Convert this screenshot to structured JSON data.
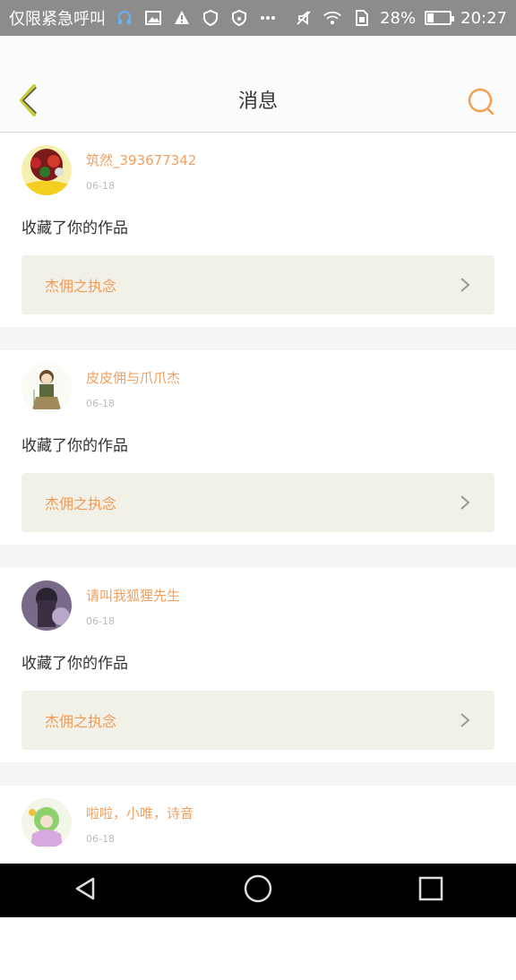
{
  "status_bar": {
    "carrier": "仅限紧急呼叫",
    "battery_percent": "28%",
    "time": "20:27",
    "icons_left": [
      "headset-icon",
      "image-icon",
      "warning-icon",
      "shield-icon",
      "shield-wifi-icon",
      "more-icon"
    ],
    "icons_right": [
      "mute-icon",
      "wifi-icon",
      "sim-icon",
      "battery-icon"
    ]
  },
  "header": {
    "title": "消息",
    "back_icon": "chevron-left-icon",
    "search_icon": "search-icon"
  },
  "messages": [
    {
      "username": "筑然_393677342",
      "date": "06-18",
      "action": "收藏了你的作品",
      "work_title": "杰佣之执念"
    },
    {
      "username": "皮皮佣与爪爪杰",
      "date": "06-18",
      "action": "收藏了你的作品",
      "work_title": "杰佣之执念"
    },
    {
      "username": "请叫我狐狸先生",
      "date": "06-18",
      "action": "收藏了你的作品",
      "work_title": "杰佣之执念"
    },
    {
      "username": "啦啦，小唯，诗音",
      "date": "06-18"
    }
  ],
  "nav_bar": {
    "icons": [
      "back-icon",
      "home-icon",
      "recents-icon"
    ]
  },
  "colors": {
    "accent": "#f29a56",
    "link_bg": "#f1f1e8",
    "status_bg": "#8c8c8c"
  }
}
